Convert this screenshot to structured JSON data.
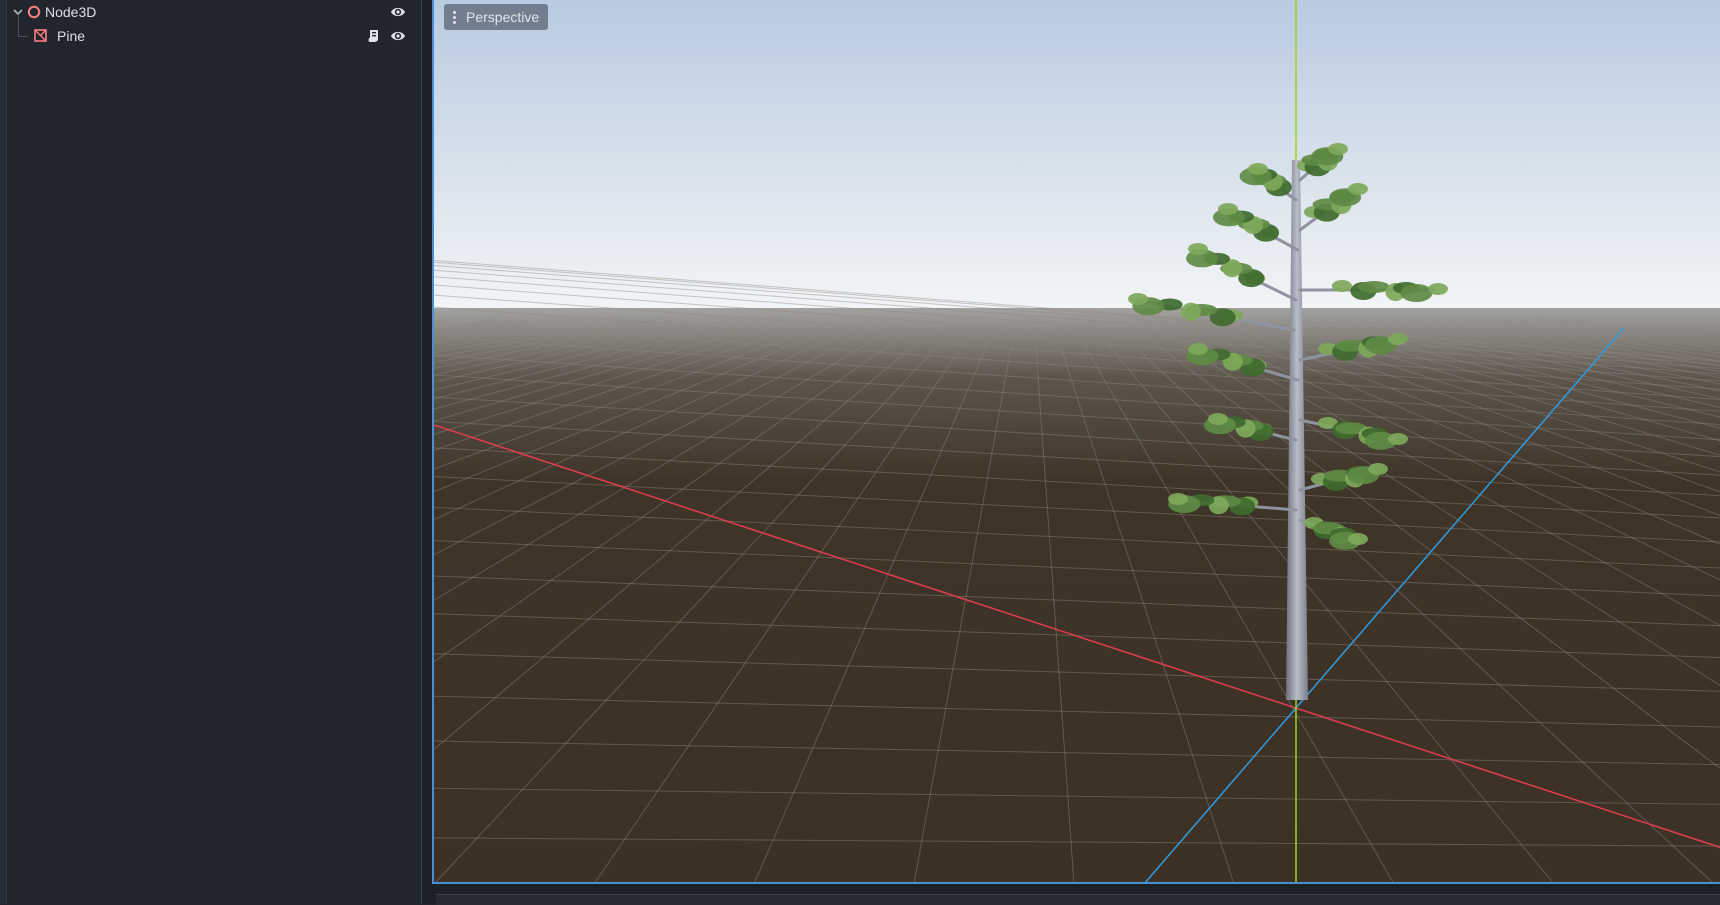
{
  "scene_tree": {
    "nodes": [
      {
        "label": "Node3D",
        "icon": "node3d-icon",
        "visible": true
      },
      {
        "label": "Pine",
        "icon": "mesh-instance-icon",
        "visible": true,
        "has_script": true
      }
    ]
  },
  "viewport": {
    "view_mode_label": "Perspective"
  },
  "colors": {
    "x_axis": "#e33c52",
    "y_axis": "#9cd31c",
    "z_axis": "#2f9be0",
    "selection_border": "#4a8fd1",
    "node_icon": "#fc7f7f"
  }
}
